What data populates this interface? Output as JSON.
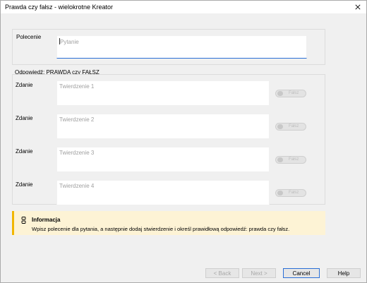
{
  "window": {
    "title": "Prawda czy fałsz - wielokrotne Kreator"
  },
  "question": {
    "label": "Polecenie",
    "placeholder": "Pytanie"
  },
  "answers": {
    "section_title": "Odpowiedź: PRAWDA czy FAŁSZ",
    "items": [
      {
        "label": "Zdanie",
        "placeholder": "Twierdzenie 1",
        "toggle_label": "Fałsz"
      },
      {
        "label": "Zdanie",
        "placeholder": "Twierdzenie 2",
        "toggle_label": "Fałsz"
      },
      {
        "label": "Zdanie",
        "placeholder": "Twierdzenie 3",
        "toggle_label": "Fałsz"
      },
      {
        "label": "Zdanie",
        "placeholder": "Twierdzenie 4",
        "toggle_label": "Fałsz"
      }
    ]
  },
  "info": {
    "icon": "info-icon",
    "title": "Informacja",
    "text": "Wpisz polecenie dla pytania, a następnie dodaj stwierdzenie i określ prawidłową odpowiedź: prawda czy fałsz."
  },
  "buttons": {
    "back": "< Back",
    "next": "Next >",
    "cancel": "Cancel",
    "help": "Help"
  },
  "colors": {
    "accent": "#2a6fd6",
    "info_bar": "#f1b600",
    "info_bg": "#fdf3d5"
  }
}
